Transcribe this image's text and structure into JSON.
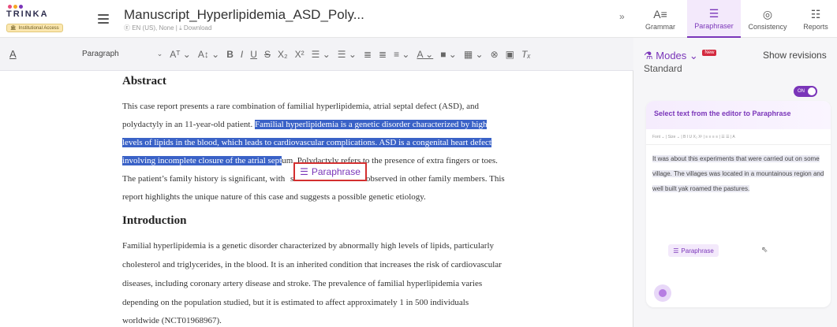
{
  "header": {
    "logo_text": "TRINKA",
    "badge": "Institutional Access",
    "doc_title": "Manuscript_Hyperlipidemia_ASD_Poly...",
    "doc_meta": "Ⓔ EN (US), None | ⤓ Download",
    "collapse": "»"
  },
  "toolbar": {
    "text_color_btn": "A",
    "paragraph_style": "Paragraph",
    "items": [
      "Aᵀ ⌄",
      "A↕ ⌄",
      "B",
      "I",
      "U",
      "S",
      "X₂",
      "X²",
      "☰ ⌄",
      "☰ ⌄",
      "≣",
      "≣",
      "≡ ⌄",
      "A ⌄",
      "■ ⌄",
      "▦ ⌄",
      "⊗",
      "▣",
      "Tₓ"
    ]
  },
  "document": {
    "abstract_heading": "Abstract",
    "abstract_lines": [
      {
        "pre": "This case report presents a rare combination of familial hyperlipidemia, atrial septal defect (ASD), and",
        "hl": "",
        "post": ""
      },
      {
        "pre": "polydactyly in an 11-year-old patient. ",
        "hl": "Familial hyperlipidemia is a genetic disorder characterized by high",
        "post": ""
      },
      {
        "pre": "",
        "hl": "levels of lipids in the blood, which leads to cardiovascular complications. ASD is a congenital heart defect",
        "post": ""
      },
      {
        "pre": "",
        "hl": "involving incomplete closure of the atrial sept",
        "post": "um. Polydactyly refers to the presence of extra fingers or toes."
      },
      {
        "pre": "The patient’s family history is significant, with ",
        "hl": "",
        "post": "similar abnormalities observed in other family members. This"
      },
      {
        "pre": "report highlights the unique nature of this case and suggests a possible genetic etiology.",
        "hl": "",
        "post": ""
      }
    ],
    "intro_heading": "Introduction",
    "intro_lines": [
      "Familial hyperlipidemia is a genetic disorder characterized by abnormally high levels of lipids, particularly",
      "cholesterol and triglycerides, in the blood. It is an inherited condition that increases the risk of cardiovascular",
      "diseases, including coronary artery disease and stroke. The prevalence of familial hyperlipidemia varies",
      "depending on the population studied, but it is estimated to affect approximately 1 in 500 individuals",
      "worldwide (NCT01968967)."
    ],
    "paraphrase_popup": "Paraphrase"
  },
  "right_panel": {
    "tabs": [
      {
        "label": "Grammar",
        "icon": "A≡"
      },
      {
        "label": "Paraphraser",
        "icon": "☰"
      },
      {
        "label": "Consistency",
        "icon": "◎"
      },
      {
        "label": "Reports",
        "icon": "☷"
      }
    ],
    "modes_label": "⚗ Modes ⌄",
    "new_badge": "New",
    "mode_value": "Standard",
    "show_revisions": "Show revisions",
    "toggle_label": "ON",
    "card_heading": "Select text from the editor to Paraphrase",
    "mini_toolbar": "Font  ⌄ | Size  ⌄ | B I U X₂ X² | ≡ ≡ ≡ ≡ | ☰ ☰ | A",
    "sample_text": "It was about this experiments that were carried out on some village. The villages was located in a mountainous region and well built yak roamed the pastures.",
    "sample_paraphrase_btn": "Paraphrase"
  }
}
